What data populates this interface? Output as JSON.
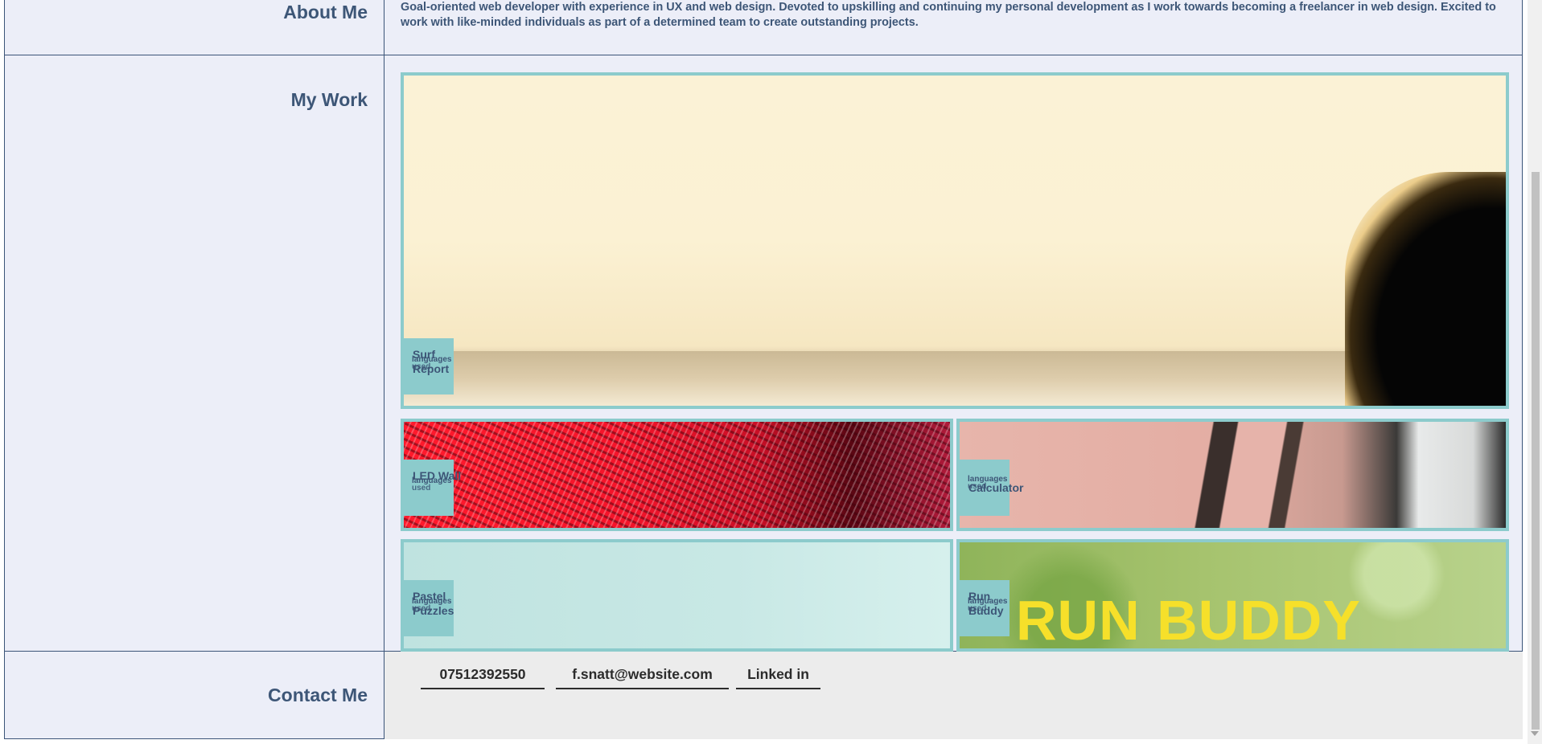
{
  "about": {
    "label": "About Me",
    "text": "Goal-oriented web developer with experience in UX and web design. Devoted to upskilling and continuing my personal development as I work towards becoming a freelancer in web design. Excited to work with like-minded individuals as part of a determined team to create outstanding projects."
  },
  "work": {
    "label": "My Work",
    "projects": [
      {
        "title": "Surf Report",
        "languages": "languages",
        "used": "used"
      },
      {
        "title": "LED Wall",
        "languages": "languages",
        "used": "used"
      },
      {
        "title": "Calculator",
        "languages": "languages",
        "used": "used"
      },
      {
        "title": "Pastel Puzzles",
        "languages": "languages",
        "used": "used"
      },
      {
        "title": "Run Buddy",
        "languages": "languages",
        "used": "used",
        "banner": "RUN BUDDY"
      }
    ]
  },
  "contact": {
    "label": "Contact Me",
    "phone": "07512392550",
    "email": "f.snatt@website.com",
    "linkedin": "Linked in"
  },
  "colors": {
    "accent": "#8ccbcc",
    "text": "#3d5677",
    "row_bg": "#eceef8"
  }
}
